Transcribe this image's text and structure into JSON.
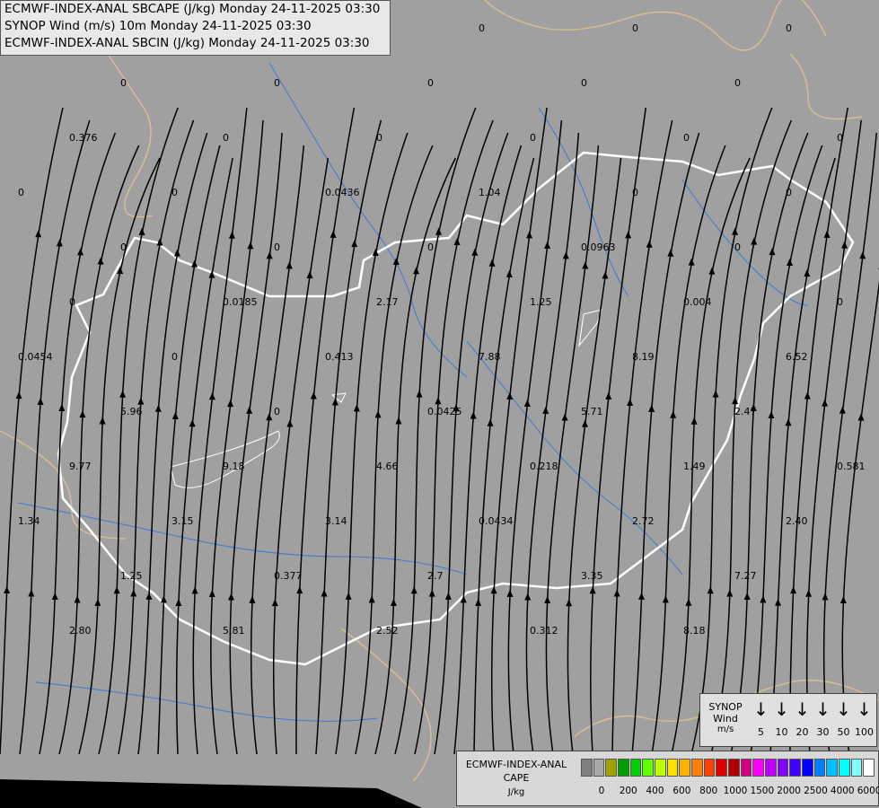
{
  "header": {
    "line1": "ECMWF-INDEX-ANAL SBCAPE (J/kg) Monday 24-11-2025 03:30",
    "line2": "SYNOP Wind (m/s) 10m Monday 24-11-2025 03:30",
    "line3": "ECMWF-INDEX-ANAL SBCIN (J/kg) Monday 24-11-2025 03:30"
  },
  "wind_legend": {
    "title1": "SYNOP",
    "title2": "Wind",
    "unit": "m/s",
    "speeds": [
      "5",
      "10",
      "20",
      "30",
      "50",
      "100"
    ]
  },
  "cape_legend": {
    "title1": "ECMWF-INDEX-ANAL",
    "title2": "CAPE",
    "unit": "J/kg",
    "ticks": [
      "0",
      "200",
      "400",
      "600",
      "800",
      "1000",
      "1500",
      "2000",
      "2500",
      "4000",
      "6000"
    ],
    "colors": [
      "#808080",
      "#a8a8a8",
      "#a0a000",
      "#00a000",
      "#00d000",
      "#60ff00",
      "#c0ff00",
      "#ffe000",
      "#ffb000",
      "#ff8000",
      "#ff4000",
      "#e00000",
      "#b00000",
      "#d00080",
      "#ff00ff",
      "#c000ff",
      "#8000ff",
      "#4000ff",
      "#0000ff",
      "#0080ff",
      "#00c0ff",
      "#00ffff",
      "#80ffff",
      "#ffffff"
    ]
  },
  "cape_values": [
    "0",
    "0",
    "0",
    "0",
    "0",
    "0",
    "0",
    "0",
    "0",
    "0",
    "0",
    "0.376",
    "0",
    "0",
    "0",
    "0",
    "0",
    "0",
    "0",
    "0.0436",
    "1.04",
    "0",
    "0",
    "0",
    "0",
    "0",
    "0.0963",
    "0",
    "0",
    "0.0185",
    "2.17",
    "1.25",
    "0.004",
    "0",
    "0.0454",
    "0",
    "0.413",
    "7.88",
    "8.19",
    "6.52",
    "5.96",
    "0",
    "0.0425",
    "5.71",
    "2.47",
    "9.77",
    "9.18",
    "4.66",
    "0.218",
    "1.49",
    "0.581",
    "1.34",
    "3.15",
    "3.14",
    "0.0434",
    "2.72",
    "2.40",
    "1.25",
    "0.377",
    "2.7",
    "3.35",
    "7.27",
    "2.80",
    "5.81",
    "2.52",
    "0.312",
    "8.18"
  ]
}
